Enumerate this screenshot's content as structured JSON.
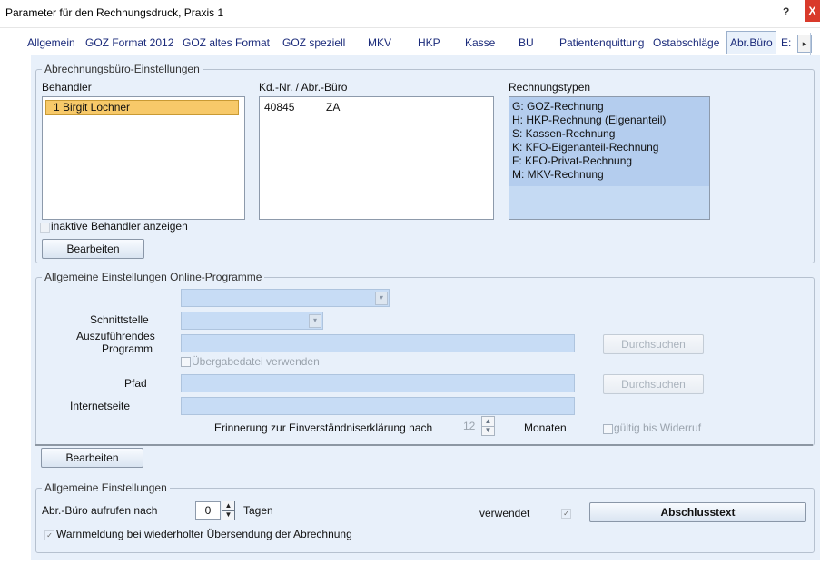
{
  "window": {
    "title": "Parameter für den Rechnungsdruck, Praxis 1",
    "help_label": "?",
    "close_label": "X"
  },
  "tabs": [
    {
      "label": "Allgemein"
    },
    {
      "label": "GOZ Format 2012"
    },
    {
      "label": "GOZ altes Format"
    },
    {
      "label": "GOZ speziell"
    },
    {
      "label": "MKV"
    },
    {
      "label": "HKP"
    },
    {
      "label": "Kasse"
    },
    {
      "label": "BU"
    },
    {
      "label": "Patientenquittung"
    },
    {
      "label": "Ostabschläge"
    },
    {
      "label": "Abr.Büro",
      "active": true
    },
    {
      "label": "E:"
    }
  ],
  "tab_scroll_label": "▸",
  "abrechnung": {
    "legend": "Abrechnungsbüro-Einstellungen",
    "behandler_header": "Behandler",
    "kdnr_header": "Kd.-Nr. / Abr.-Büro",
    "typen_header": "Rechnungstypen",
    "behandler": [
      {
        "label": "1 Birgit Lochner",
        "selected": true
      }
    ],
    "kd_rows": [
      {
        "nr": "40845",
        "buero": "ZA"
      }
    ],
    "rechnungstypen": [
      "G:  GOZ-Rechnung",
      "H:  HKP-Rechnung (Eigenanteil)",
      "S:  Kassen-Rechnung",
      "K:  KFO-Eigenanteil-Rechnung",
      "F:  KFO-Privat-Rechnung",
      "M:  MKV-Rechnung"
    ],
    "inactive_label": "inaktive Behandler anzeigen",
    "inactive_checked": false,
    "edit_button": "Bearbeiten"
  },
  "online": {
    "legend": "Allgemeine Einstellungen Online-Programme",
    "schnittstelle_label": "Schnittstelle",
    "programm_label_1": "Auszuführendes",
    "programm_label_2": "Programm",
    "uebergabe_label": "Übergabedatei verwenden",
    "pfad_label": "Pfad",
    "internet_label": "Internetseite",
    "browse_button_1": "Durchsuchen",
    "browse_button_2": "Durchsuchen",
    "erinnerung_label": "Erinnerung zur Einverständniserklärung nach",
    "erinnerung_value": "12",
    "monate_label": "Monaten",
    "gueltig_label": "gültig bis Widerruf",
    "edit_button": "Bearbeiten"
  },
  "allgemein": {
    "legend": "Allgemeine Einstellungen",
    "aufrufen_label": "Abr.-Büro aufrufen nach",
    "tage_value": "0",
    "tage_label": "Tagen",
    "verwendet_label": "verwendet",
    "verwendet_checked": true,
    "abschluss_button": "Abschlusstext",
    "warnung_label": "Warnmeldung bei wiederholter Übersendung der Abrechnung",
    "warnung_checked": true,
    "check_mark": "✓"
  },
  "icons": {
    "dropdown_arrow": "▾",
    "spin_up": "▲",
    "spin_down": "▼"
  }
}
